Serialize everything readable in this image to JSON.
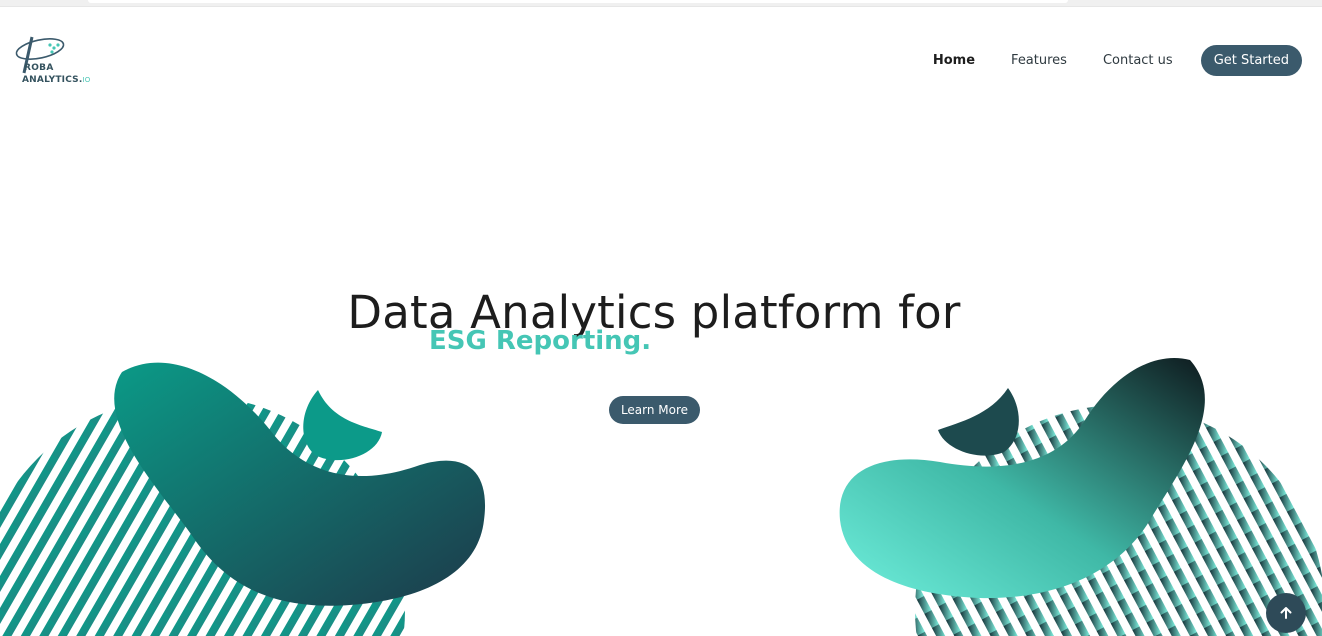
{
  "brand": {
    "logo_line1": "ROBA",
    "logo_line2": "ANALYTICS.",
    "logo_suffix": "IO",
    "primary_color": "#3b5a6c",
    "accent_color": "#45c6b5"
  },
  "nav": {
    "items": [
      {
        "label": "Home",
        "active": true
      },
      {
        "label": "Features",
        "active": false
      },
      {
        "label": "Contact us",
        "active": false
      }
    ],
    "cta_label": "Get Started"
  },
  "hero": {
    "title": "Data Analytics platform for",
    "subtitle": "ESG Reporting.",
    "button_label": "Learn More"
  },
  "icons": {
    "scroll_top": "arrow-up-icon",
    "logo": "proba-logo-icon"
  }
}
